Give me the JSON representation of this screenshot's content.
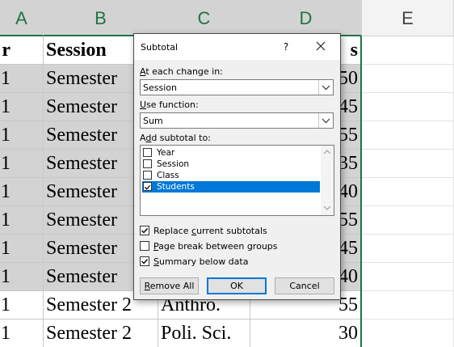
{
  "sheet": {
    "columns": [
      "A",
      "B",
      "C",
      "D",
      "E"
    ],
    "header_row": {
      "a": "r",
      "b": "Session",
      "d": "s"
    },
    "rows": [
      {
        "a": "1",
        "b": "Semester",
        "d": "50"
      },
      {
        "a": "1",
        "b": "Semester",
        "d": "45"
      },
      {
        "a": "1",
        "b": "Semester",
        "d": "55"
      },
      {
        "a": "1",
        "b": "Semester",
        "d": "35"
      },
      {
        "a": "1",
        "b": "Semester",
        "d": "40"
      },
      {
        "a": "1",
        "b": "Semester",
        "d": "55"
      },
      {
        "a": "1",
        "b": "Semester",
        "d": "45"
      },
      {
        "a": "1",
        "b": "Semester",
        "d": "40"
      },
      {
        "a": "1",
        "b": "Semester 2",
        "c": "Anthro.",
        "d": "55"
      },
      {
        "a": "1",
        "b": "Semester 2",
        "c": "Poli. Sci.",
        "d": "30"
      }
    ],
    "selection_color": "#217346"
  },
  "dialog": {
    "title": "Subtotal",
    "help": "?",
    "at_each_change_label_ul": "A",
    "at_each_change_label_rest": "t each change in:",
    "at_each_change_value": "Session",
    "use_function_label_ul": "U",
    "use_function_label_rest": "se function:",
    "use_function_value": "Sum",
    "add_subtotal_label_ul": "A",
    "add_subtotal_label_mid": "d",
    "add_subtotal_label_rest": "d subtotal to:",
    "add_subtotal_items": [
      {
        "label": "Year",
        "checked": false
      },
      {
        "label": "Session",
        "checked": false
      },
      {
        "label": "Class",
        "checked": false
      },
      {
        "label": "Students",
        "checked": true
      }
    ],
    "replace_label_pre": "Replace ",
    "replace_label_ul": "c",
    "replace_label_rest": "urrent subtotals",
    "replace_checked": true,
    "page_break_label_ul": "P",
    "page_break_label_rest": "age break between groups",
    "page_break_checked": false,
    "summary_label_ul": "S",
    "summary_label_rest": "ummary below data",
    "summary_checked": true,
    "remove_all_ul": "R",
    "remove_all_rest": "emove All",
    "ok": "OK",
    "cancel": "Cancel",
    "accent_color": "#0078d7"
  }
}
